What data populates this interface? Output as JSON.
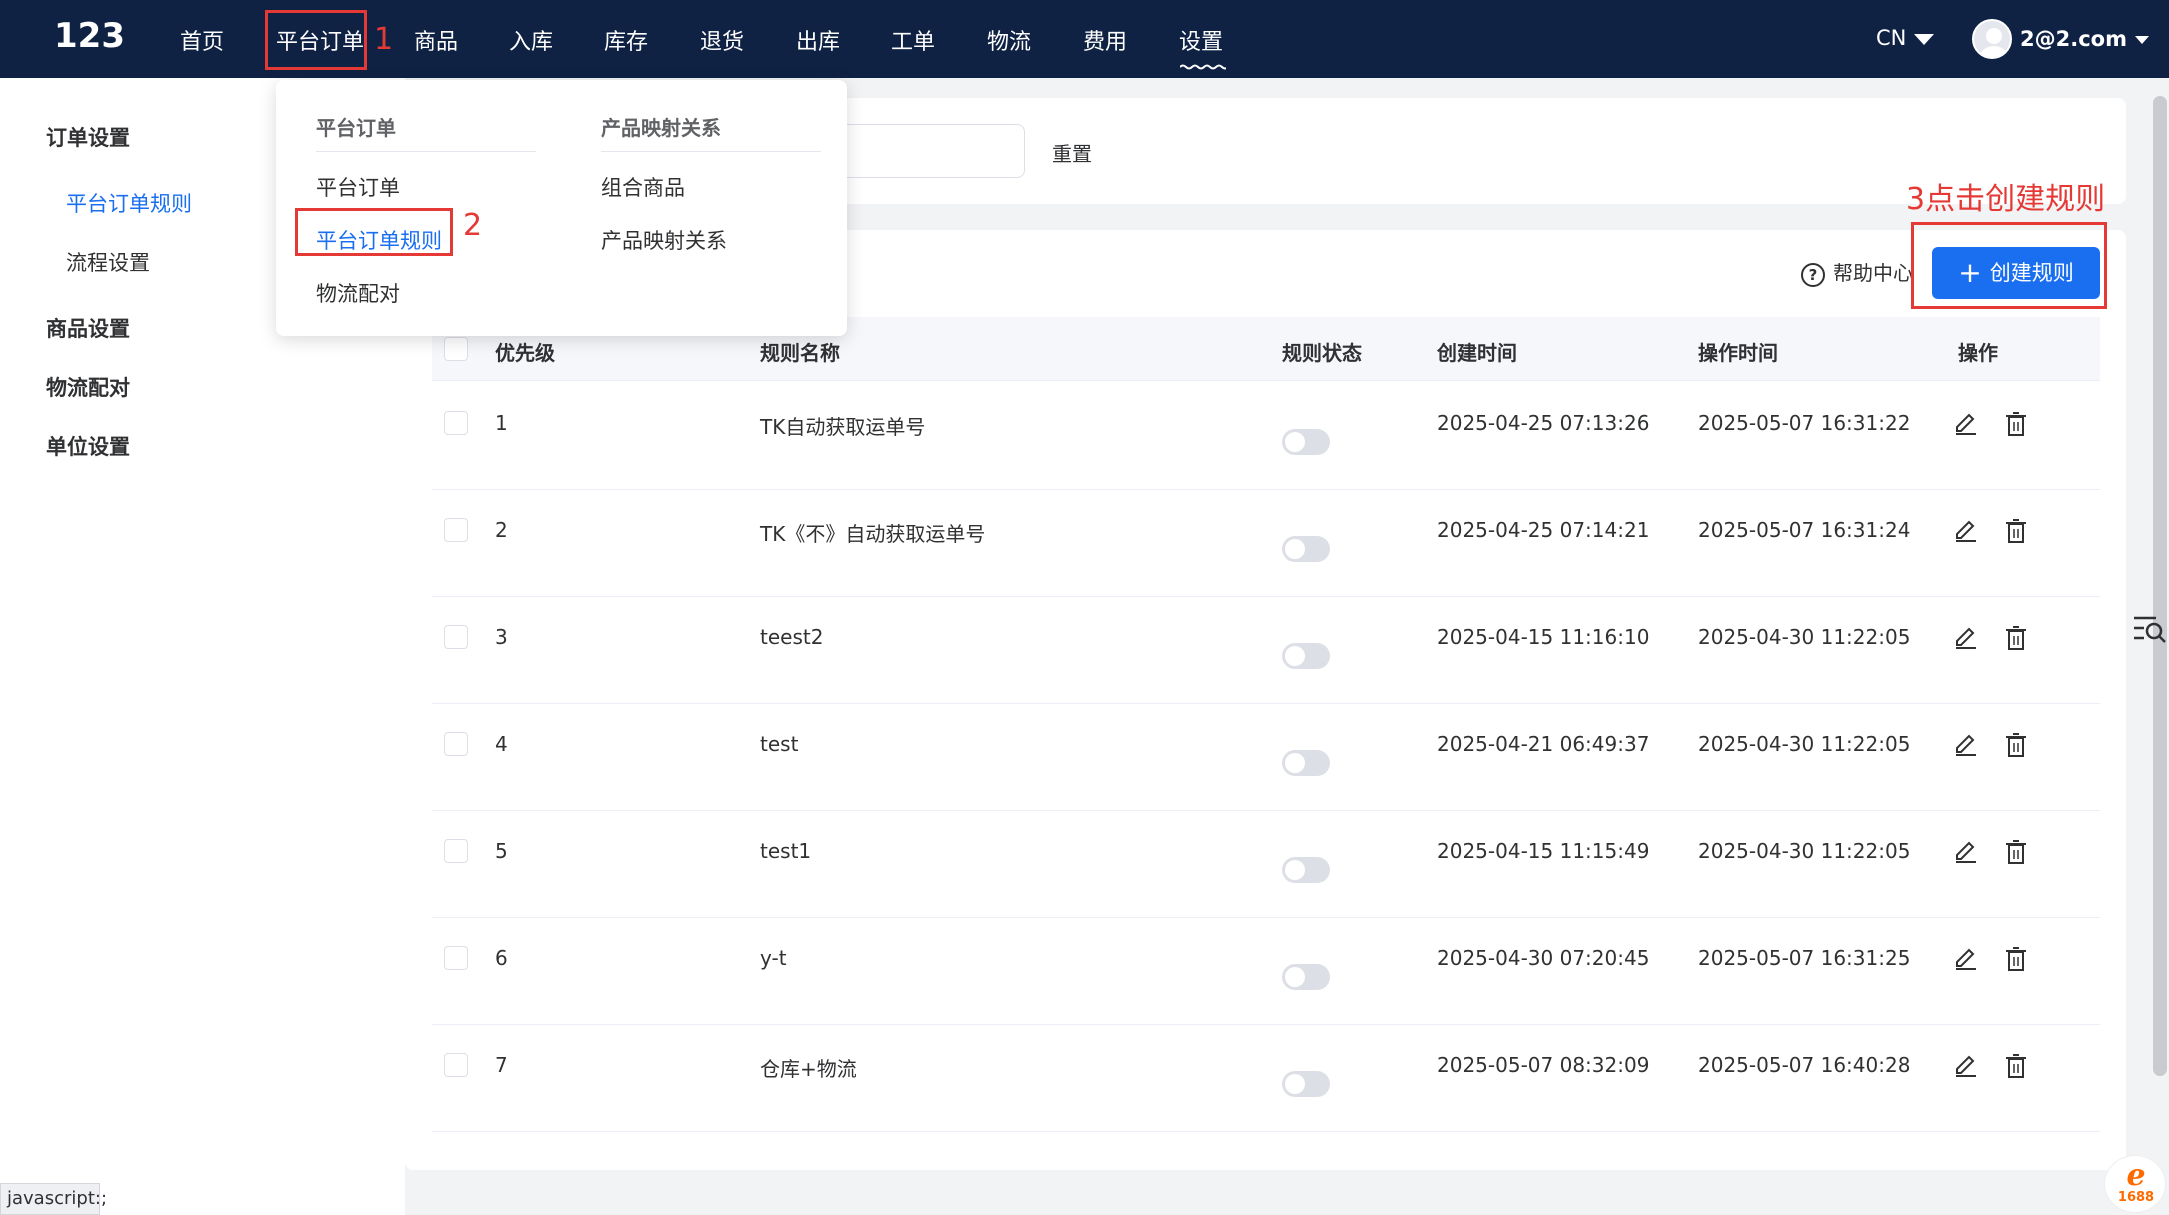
{
  "app": {
    "logo": "123"
  },
  "nav": {
    "items": [
      "首页",
      "平台订单",
      "商品",
      "入库",
      "库存",
      "退货",
      "出库",
      "工单",
      "物流",
      "费用",
      "设置"
    ],
    "lang": "CN",
    "user": "2@2.com"
  },
  "sidebar": {
    "group1": "订单设置",
    "sub1": "平台订单规则",
    "sub2": "流程设置",
    "group2": "商品设置",
    "group3": "物流配对",
    "group4": "单位设置"
  },
  "search": {
    "reset_label": "重置"
  },
  "toolbar": {
    "help_label": "帮助中心",
    "create_label": "创建规则"
  },
  "table": {
    "headers": [
      "优先级",
      "规则名称",
      "规则状态",
      "创建时间",
      "操作时间",
      "操作"
    ],
    "rows": [
      {
        "priority": "1",
        "name": "TK自动获取运单号",
        "created": "2025-04-25 07:13:26",
        "updated": "2025-05-07 16:31:22"
      },
      {
        "priority": "2",
        "name": "TK《不》自动获取运单号",
        "created": "2025-04-25 07:14:21",
        "updated": "2025-05-07 16:31:24"
      },
      {
        "priority": "3",
        "name": "teest2",
        "created": "2025-04-15 11:16:10",
        "updated": "2025-04-30 11:22:05"
      },
      {
        "priority": "4",
        "name": "test",
        "created": "2025-04-21 06:49:37",
        "updated": "2025-04-30 11:22:05"
      },
      {
        "priority": "5",
        "name": "test1",
        "created": "2025-04-15 11:15:49",
        "updated": "2025-04-30 11:22:05"
      },
      {
        "priority": "6",
        "name": "y-t",
        "created": "2025-04-30 07:20:45",
        "updated": "2025-05-07 16:31:25"
      },
      {
        "priority": "7",
        "name": "仓库+物流",
        "created": "2025-05-07 08:32:09",
        "updated": "2025-05-07 16:40:28"
      }
    ]
  },
  "dropdown": {
    "col1_header": "平台订单",
    "col1_items": [
      "平台订单",
      "平台订单规则",
      "物流配对"
    ],
    "col2_header": "产品映射关系",
    "col2_items": [
      "组合商品",
      "产品映射关系"
    ]
  },
  "annotations": {
    "a1": "1",
    "a2": "2",
    "a3": "3点击创建规则"
  },
  "statusbar": {
    "text": "javascript:;"
  },
  "badge": {
    "text": "1688"
  },
  "colors": {
    "topbar": "#0f2244",
    "primary": "#1a6ff0",
    "annotation": "#e53935"
  }
}
